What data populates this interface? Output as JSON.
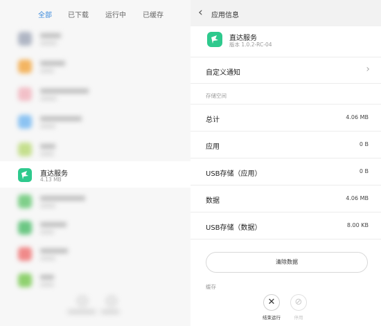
{
  "tabs": [
    {
      "label": "全部",
      "active": true
    },
    {
      "label": "已下载",
      "active": false
    },
    {
      "label": "运行中",
      "active": false
    },
    {
      "label": "已缓存",
      "active": false
    }
  ],
  "app_list": {
    "highlighted": {
      "name": "直达服务",
      "size": "4.13 MB"
    }
  },
  "header": {
    "title": "应用信息"
  },
  "app": {
    "name": "直达服务",
    "version": "版本 1.0.2-RC-04"
  },
  "rows": {
    "custom_notification": "自定义通知",
    "storage_section": "存储空间",
    "total": {
      "label": "总计",
      "value": "4.06 MB"
    },
    "app_size": {
      "label": "应用",
      "value": "0 B"
    },
    "usb_app": {
      "label": "USB存储（应用）",
      "value": "0 B"
    },
    "data": {
      "label": "数据",
      "value": "4.06 MB"
    },
    "usb_data": {
      "label": "USB存储（数据）",
      "value": "8.00 KB"
    }
  },
  "clear_data_label": "清除数据",
  "cache_section": "缓存",
  "actions": {
    "force_stop": "结束运行",
    "disable": "停用"
  },
  "colors": {
    "accent": "#3d8bdc",
    "app_icon": "#2ec98d",
    "force_stop_icon": "#333333",
    "disabled_icon": "#c8c8c8"
  }
}
